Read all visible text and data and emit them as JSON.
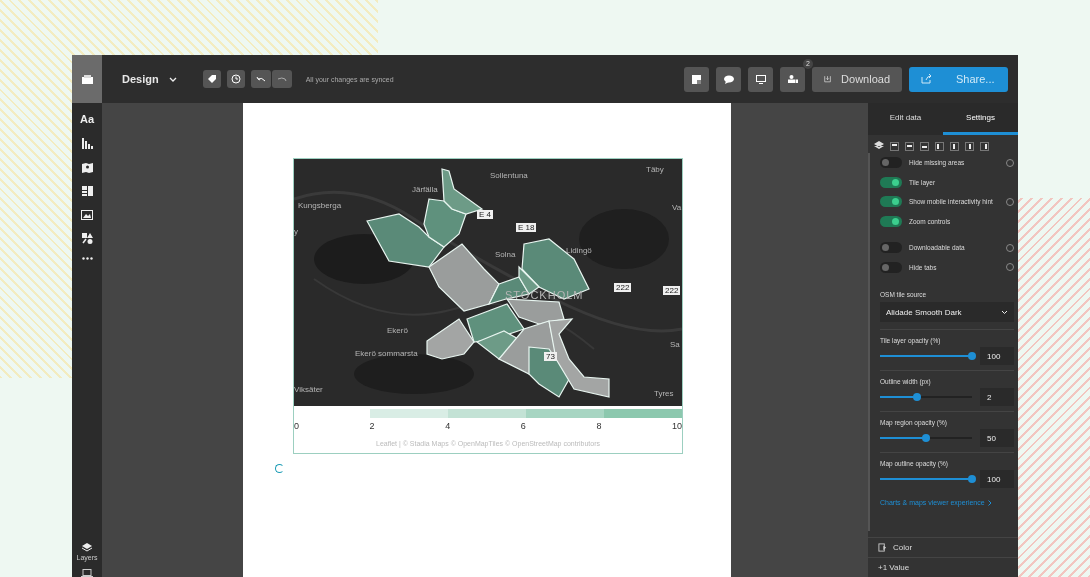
{
  "topbar": {
    "mode": "Design",
    "sync_status": "All your changes are synced",
    "collaborators_badge": "2",
    "download": "Download",
    "share": "Share..."
  },
  "rail": {
    "text_tool": "Aa",
    "layers": "Layers"
  },
  "map": {
    "labels": [
      "Täby",
      "Sollentuna",
      "Järfälla",
      "Kungsberga",
      "Va",
      "E 4",
      "E 18",
      "y",
      "Lidingö",
      "Solna",
      "222",
      "222",
      "STOCKHOLM",
      "Ekerö",
      "Sa",
      "Ekerö sommarsta",
      "73",
      "Viksäter",
      "Tyres"
    ],
    "legend_ticks": [
      "0",
      "2",
      "4",
      "6",
      "8",
      "10"
    ],
    "attribution": "Leaflet | © Stadia Maps © OpenMapTiles © OpenStreetMap contributors"
  },
  "panel": {
    "tabs": [
      {
        "label": "Edit data",
        "selected": false
      },
      {
        "label": "Settings",
        "selected": true
      }
    ],
    "toggles": [
      {
        "label": "Hide missing areas",
        "on": false,
        "help": true
      },
      {
        "label": "Tile layer",
        "on": true,
        "help": false
      },
      {
        "label": "Show mobile interactivity hint",
        "on": true,
        "help": true
      },
      {
        "label": "Zoom controls",
        "on": true,
        "help": false
      },
      {
        "label": "Downloadable data",
        "on": false,
        "help": true
      },
      {
        "label": "Hide tabs",
        "on": false,
        "help": true
      }
    ],
    "tile_source": {
      "label": "OSM tile source",
      "value": "Alidade Smooth Dark"
    },
    "sliders": [
      {
        "label": "Tile layer opacity (%)",
        "level": 1,
        "value": "100"
      },
      {
        "label": "Outline width (px)",
        "level": 0.4,
        "value": "2"
      },
      {
        "label": "Map region opacity (%)",
        "level": 0.5,
        "value": "50"
      },
      {
        "label": "Map outline opacity (%)",
        "level": 1,
        "value": "100"
      }
    ],
    "link": "Charts & maps viewer experience",
    "sections": [
      {
        "label": "Color",
        "kind": "icon"
      },
      {
        "label": "+1 Value",
        "kind": "plain"
      }
    ]
  }
}
